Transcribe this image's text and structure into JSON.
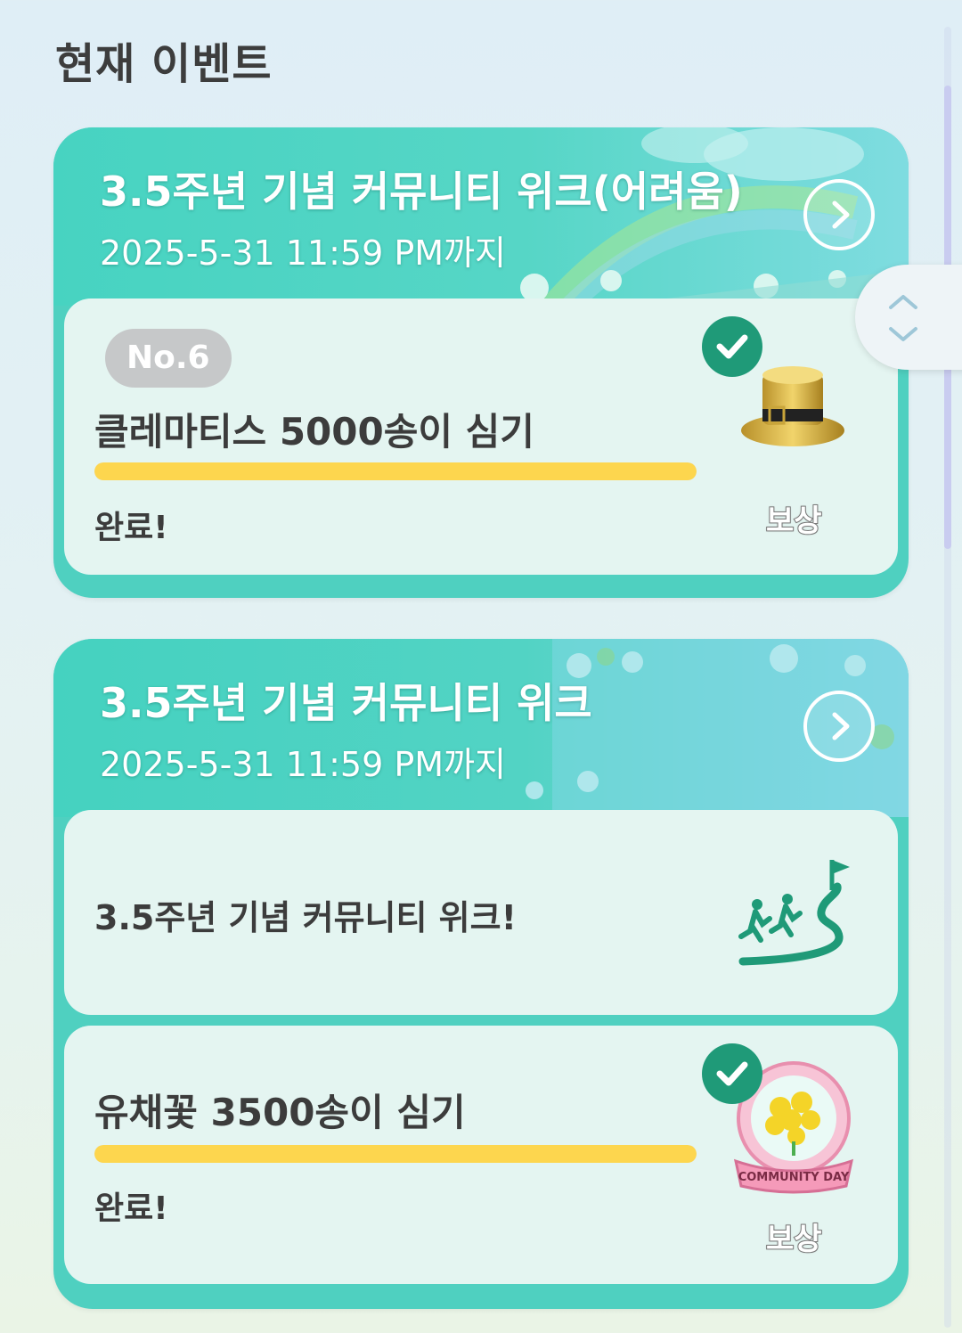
{
  "section": {
    "title": "현재 이벤트"
  },
  "events": [
    {
      "title": "3.5주년 기념 커뮤니티 위크(어려움)",
      "deadline": "2025-5-31 11:59 PM까지",
      "arrow_icon": "chevron-right-icon",
      "tasks": [
        {
          "badge": "No.6",
          "text": "클레마티스 5000송이 심기",
          "progress": 1.0,
          "status": "완료!",
          "reward_label": "보상",
          "reward_icon": "gold-top-hat",
          "completed": true
        }
      ]
    },
    {
      "title": "3.5주년 기념 커뮤니티 위크",
      "deadline": "2025-5-31 11:59 PM까지",
      "arrow_icon": "chevron-right-icon",
      "tasks": [
        {
          "text": "3.5주년 기념 커뮤니티 위크!",
          "icon": "walking-path-flag-icon"
        },
        {
          "text": "유채꽃 3500송이 심기",
          "progress": 1.0,
          "status": "완료!",
          "reward_label": "보상",
          "reward_icon": "community-day-flower-badge",
          "completed": true
        }
      ]
    }
  ],
  "colors": {
    "accent": "#4fd0c0",
    "check": "#1f9a78",
    "progress": "#fdd64e",
    "panel": "#e4f5f1"
  }
}
